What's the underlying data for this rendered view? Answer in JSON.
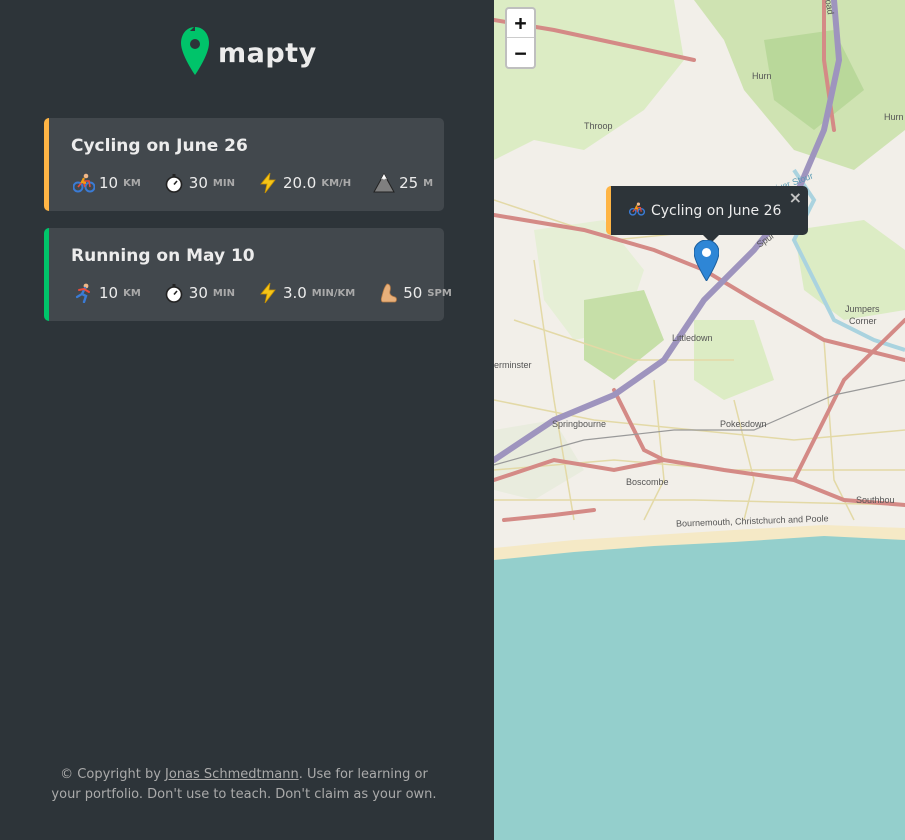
{
  "logo": {
    "text": "mapty",
    "icon": "map-pin-icon"
  },
  "workouts": [
    {
      "type": "cycling",
      "title": "Cycling on June 26",
      "accent": "#ffb545",
      "details": [
        {
          "icon": "cyclist-icon",
          "value": "10",
          "unit": "km"
        },
        {
          "icon": "stopwatch-icon",
          "value": "30",
          "unit": "min"
        },
        {
          "icon": "lightning-icon",
          "value": "20.0",
          "unit": "km/h"
        },
        {
          "icon": "mountain-icon",
          "value": "25",
          "unit": "m"
        }
      ]
    },
    {
      "type": "running",
      "title": "Running on May 10",
      "accent": "#00c46a",
      "details": [
        {
          "icon": "runner-icon",
          "value": "10",
          "unit": "km"
        },
        {
          "icon": "stopwatch-icon",
          "value": "30",
          "unit": "min"
        },
        {
          "icon": "lightning-icon",
          "value": "3.0",
          "unit": "min/km"
        },
        {
          "icon": "foot-icon",
          "value": "50",
          "unit": "spm"
        }
      ]
    }
  ],
  "copyright": {
    "prefix": "© Copyright by ",
    "author": "Jonas Schmedtmann",
    "suffix": ". Use for learning or your portfolio. Don't use to teach. Don't claim as your own."
  },
  "map": {
    "zoom_in": "+",
    "zoom_out": "−",
    "popup": {
      "text": "Cycling on June 26",
      "close": "×",
      "icon": "cyclist-icon"
    },
    "labels": {
      "throop": "Throop",
      "hurn": "Hurn",
      "littledown": "Littledown",
      "jumpers": "Jumpers",
      "corner": "Corner",
      "ferminster": "erminster",
      "springbourne": "Springbourne",
      "pokesdown": "Pokesdown",
      "boscombe": "Boscombe",
      "southbourne": "Southbou",
      "bay": "Bournemouth, Christchurch and Poole",
      "spur": "Spur",
      "river": "River Stour",
      "road": "oad",
      "hurn_right": "Hurn"
    },
    "colors": {
      "sea": "#94cfcc",
      "land": "#f2efe9",
      "green": "#cde3b0",
      "road_major": "#d48a86",
      "road_motorway": "#9e94be"
    }
  }
}
